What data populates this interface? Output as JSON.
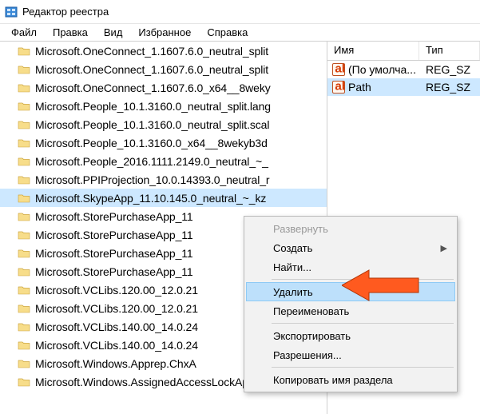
{
  "window": {
    "title": "Редактор реестра"
  },
  "menubar": {
    "items": [
      {
        "label": "Файл"
      },
      {
        "label": "Правка"
      },
      {
        "label": "Вид"
      },
      {
        "label": "Избранное"
      },
      {
        "label": "Справка"
      }
    ]
  },
  "tree": {
    "items": [
      {
        "label": "Microsoft.OneConnect_1.1607.6.0_neutral_split"
      },
      {
        "label": "Microsoft.OneConnect_1.1607.6.0_neutral_split"
      },
      {
        "label": "Microsoft.OneConnect_1.1607.6.0_x64__8weky"
      },
      {
        "label": "Microsoft.People_10.1.3160.0_neutral_split.lang"
      },
      {
        "label": "Microsoft.People_10.1.3160.0_neutral_split.scal"
      },
      {
        "label": "Microsoft.People_10.1.3160.0_x64__8wekyb3d"
      },
      {
        "label": "Microsoft.People_2016.1111.2149.0_neutral_~_"
      },
      {
        "label": "Microsoft.PPIProjection_10.0.14393.0_neutral_r"
      },
      {
        "label": "Microsoft.SkypeApp_11.10.145.0_neutral_~_kz",
        "selected": true
      },
      {
        "label": "Microsoft.StorePurchaseApp_11"
      },
      {
        "label": "Microsoft.StorePurchaseApp_11"
      },
      {
        "label": "Microsoft.StorePurchaseApp_11"
      },
      {
        "label": "Microsoft.StorePurchaseApp_11"
      },
      {
        "label": "Microsoft.VCLibs.120.00_12.0.21"
      },
      {
        "label": "Microsoft.VCLibs.120.00_12.0.21"
      },
      {
        "label": "Microsoft.VCLibs.140.00_14.0.24"
      },
      {
        "label": "Microsoft.VCLibs.140.00_14.0.24"
      },
      {
        "label": "Microsoft.Windows.Apprep.ChxA"
      },
      {
        "label": "Microsoft.Windows.AssignedAccessLockApp_10"
      }
    ]
  },
  "columns": {
    "name": "Имя",
    "type": "Тип"
  },
  "values": [
    {
      "name": "(По умолча...",
      "type": "REG_SZ"
    },
    {
      "name": "Path",
      "type": "REG_SZ",
      "selected": true
    }
  ],
  "context_menu": {
    "items": [
      {
        "label": "Развернуть",
        "disabled": true
      },
      {
        "label": "Создать",
        "submenu": true
      },
      {
        "label": "Найти...",
        "sep_after": true
      },
      {
        "label": "Удалить",
        "highlight": true
      },
      {
        "label": "Переименовать",
        "sep_after": true
      },
      {
        "label": "Экспортировать"
      },
      {
        "label": "Разрешения...",
        "sep_after": true
      },
      {
        "label": "Копировать имя раздела"
      }
    ]
  }
}
